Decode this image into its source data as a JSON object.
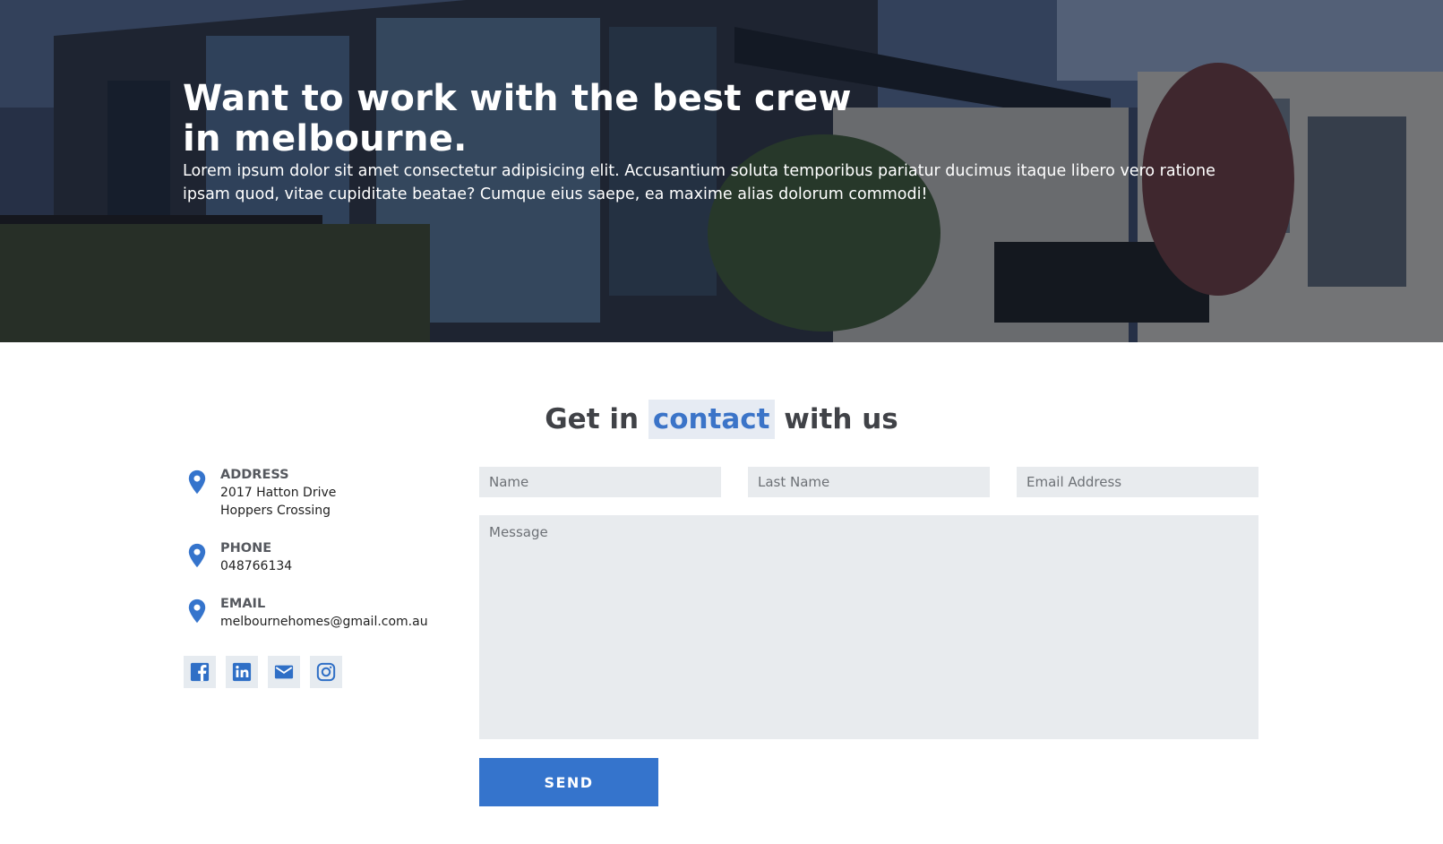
{
  "hero": {
    "title": "Want to work with the best crew in melbourne.",
    "text": "Lorem ipsum dolor sit amet consectetur adipisicing elit. Accusantium soluta temporibus pariatur ducimus itaque libero vero ratione ipsam quod, vitae cupiditate beatae? Cumque eius saepe, ea maxime alias dolorum commodi!"
  },
  "contact": {
    "title_before": "Get in",
    "title_highlight": "contact",
    "title_after": "with us",
    "accent_color": "#3b74c8"
  },
  "info": {
    "address": {
      "label": "ADDRESS",
      "line1": "2017 Hatton Drive",
      "line2": "Hoppers Crossing",
      "icon": "location-pin-icon"
    },
    "phone": {
      "label": "PHONE",
      "value": "048766134",
      "icon": "location-pin-icon"
    },
    "email": {
      "label": "EMAIL",
      "value": "melbournehomes@gmail.com.au",
      "icon": "location-pin-icon"
    }
  },
  "socials": [
    "facebook-icon",
    "linkedin-icon",
    "mail-icon",
    "instagram-icon"
  ],
  "form": {
    "name_placeholder": "Name",
    "last_name_placeholder": "Last Name",
    "email_placeholder": "Email Address",
    "message_placeholder": "Message",
    "send_label": "SEND",
    "button_color": "#3574cc"
  }
}
